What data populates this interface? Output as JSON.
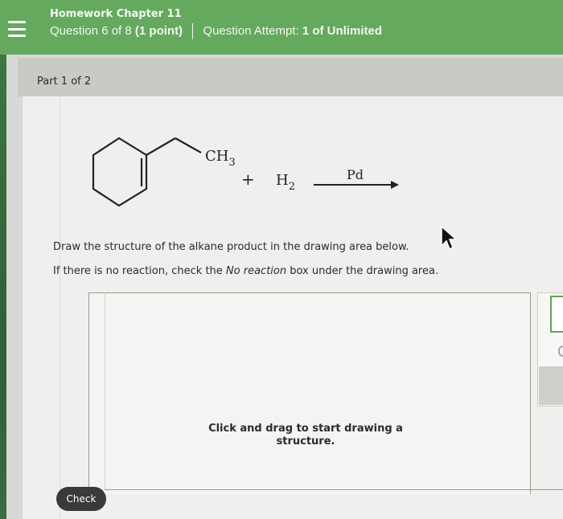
{
  "header": {
    "title": "Homework Chapter 11",
    "question_prefix": "Question 6 of 8",
    "points": "(1 point)",
    "attempt_prefix": "Question Attempt:",
    "attempt_value": "1 of Unlimited"
  },
  "part": {
    "label": "Part 1 of 2"
  },
  "reaction": {
    "methyl": "CH",
    "methyl_sub": "3",
    "plus": "+",
    "h2": "H",
    "h2_sub": "2",
    "catalyst": "Pd"
  },
  "instructions": {
    "line1": "Draw the structure of the alkane product in the drawing area below.",
    "line2_start": "If there is no reaction, check the",
    "line2_italic": "No reaction",
    "line2_end": "box under the drawing area."
  },
  "drawing_area": {
    "hint_line1": "Click and drag to start drawing a",
    "hint_line2": "structure."
  },
  "buttons": {
    "check": "Check"
  },
  "colors": {
    "header_green": "#64a95d",
    "button_dark": "#3a3a3a"
  },
  "icons": {
    "menu": "hamburger-menu-icon",
    "cursor": "mouse-pointer-icon"
  }
}
